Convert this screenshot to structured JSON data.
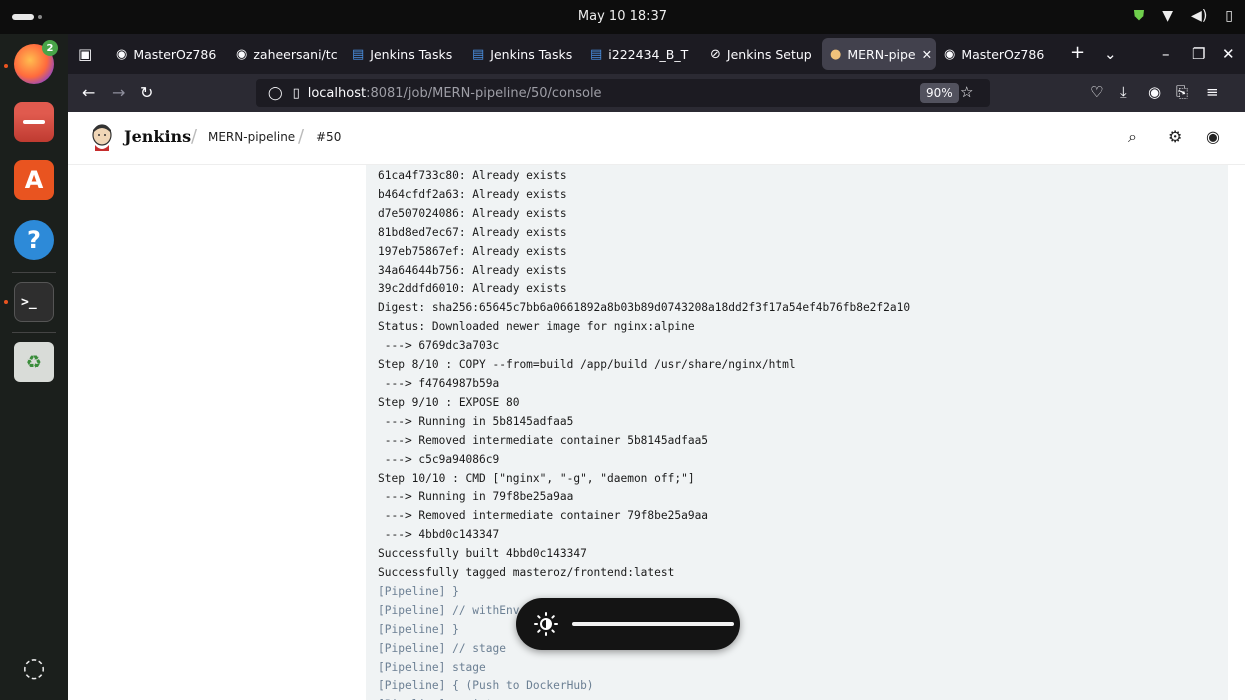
{
  "system": {
    "clock": "May 10  18:37",
    "dock": {
      "firefox_badge": "2"
    }
  },
  "browser": {
    "tabs": [
      {
        "label": "MasterOz786",
        "icon": "github-icon"
      },
      {
        "label": "zaheersani/tc",
        "icon": "github-icon"
      },
      {
        "label": "Jenkins Tasks",
        "icon": "docs-icon"
      },
      {
        "label": "Jenkins Tasks",
        "icon": "docs-icon"
      },
      {
        "label": "i222434_B_T",
        "icon": "docs-icon"
      },
      {
        "label": "Jenkins Setup",
        "icon": "circle-slash-icon"
      },
      {
        "label": "MERN-pipe",
        "icon": "jenkins-icon",
        "active": true
      },
      {
        "label": "MasterOz786",
        "icon": "github-icon"
      }
    ],
    "url": {
      "host": "localhost",
      "path": ":8081/job/MERN-pipeline/50/console"
    },
    "zoom": "90%"
  },
  "jenkins": {
    "brand": "Jenkins",
    "breadcrumb": [
      "MERN-pipeline",
      "#50"
    ]
  },
  "console": {
    "lines": [
      {
        "text": "61ca4f733c80: Already exists"
      },
      {
        "text": "b464cfdf2a63: Already exists"
      },
      {
        "text": "d7e507024086: Already exists"
      },
      {
        "text": "81bd8ed7ec67: Already exists"
      },
      {
        "text": "197eb75867ef: Already exists"
      },
      {
        "text": "34a64644b756: Already exists"
      },
      {
        "text": "39c2ddfd6010: Already exists"
      },
      {
        "text": "Digest: sha256:65645c7bb6a0661892a8b03b89d0743208a18dd2f3f17a54ef4b76fb8e2f2a10"
      },
      {
        "text": "Status: Downloaded newer image for nginx:alpine"
      },
      {
        "text": " ---> 6769dc3a703c"
      },
      {
        "text": "Step 8/10 : COPY --from=build /app/build /usr/share/nginx/html"
      },
      {
        "text": " ---> f4764987b59a"
      },
      {
        "text": "Step 9/10 : EXPOSE 80"
      },
      {
        "text": " ---> Running in 5b8145adfaa5"
      },
      {
        "text": " ---> Removed intermediate container 5b8145adfaa5"
      },
      {
        "text": " ---> c5c9a94086c9"
      },
      {
        "text": "Step 10/10 : CMD [\"nginx\", \"-g\", \"daemon off;\"]"
      },
      {
        "text": " ---> Running in 79f8be25a9aa"
      },
      {
        "text": " ---> Removed intermediate container 79f8be25a9aa"
      },
      {
        "text": " ---> 4bbd0c143347"
      },
      {
        "text": "Successfully built 4bbd0c143347"
      },
      {
        "text": "Successfully tagged masteroz/frontend:latest"
      },
      {
        "text": "[Pipeline] }",
        "pipeline": true
      },
      {
        "text": "[Pipeline] // withEnv",
        "pipeline": true
      },
      {
        "text": "[Pipeline] }",
        "pipeline": true
      },
      {
        "text": "[Pipeline] // stage",
        "pipeline": true
      },
      {
        "text": "[Pipeline] stage",
        "pipeline": true
      },
      {
        "text": "[Pipeline] { (Push to DockerHub)",
        "pipeline": true
      },
      {
        "text": "[Pipeline] script",
        "pipeline": true
      }
    ]
  },
  "osd": {
    "icon": "brightness-icon",
    "level": 1.0
  }
}
